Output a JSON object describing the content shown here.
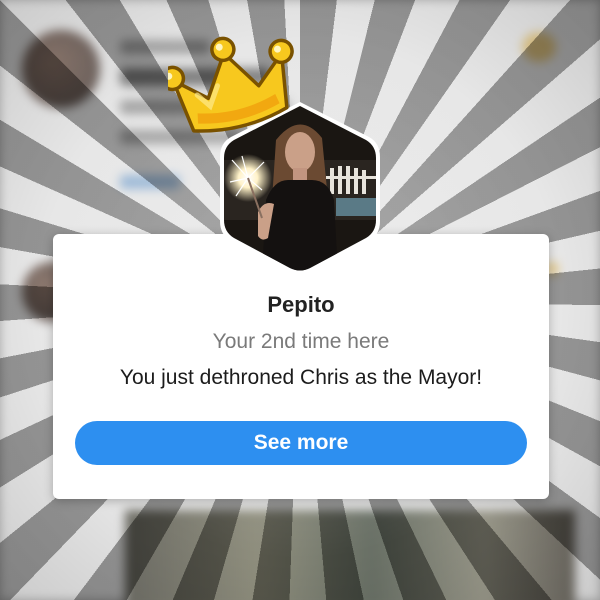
{
  "popup": {
    "user_name": "Pepito",
    "visit_count_text": "Your 2nd time here",
    "message": "You just dethroned Chris as the Mayor!",
    "button_label": "See more"
  },
  "colors": {
    "accent": "#2d8ff0",
    "crown": "#f7c81e",
    "card": "#ffffff"
  },
  "icons": {
    "crown": "crown-icon"
  }
}
